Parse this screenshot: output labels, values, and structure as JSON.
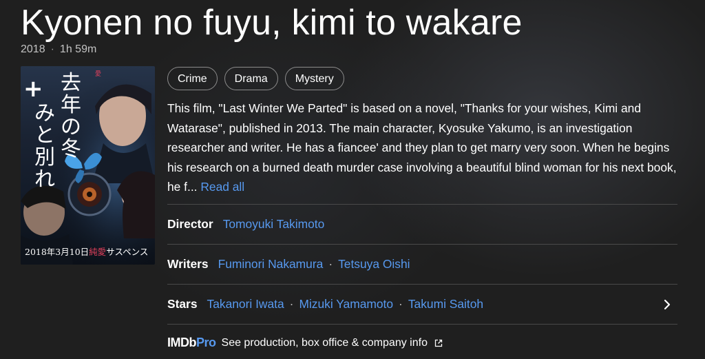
{
  "title": "Kyonen no fuyu, kimi to wakare",
  "meta": {
    "year": "2018",
    "separator": "·",
    "runtime": "1h 59m"
  },
  "poster": {
    "title_jp": "去年の冬、きみと別れ",
    "date_text": "2018年3月10日",
    "tagline_accent": "純愛",
    "tagline_rest": "サスペンス",
    "colors": {
      "accent": "#e0405b",
      "butterfly": "#4aa3e8"
    }
  },
  "genres": [
    "Crime",
    "Drama",
    "Mystery"
  ],
  "plot": {
    "text": "This film, \"Last Winter We Parted\" is based on a novel, \"Thanks for your wishes, Kimi and Watarase\", published in 2013. The main character, Kyosuke Yakumo, is an investigation researcher and writer. He has a fiancee' and they plan to get marry very soon. When he begins his research on a burned death murder case involving a beautiful blind woman for his next book, he f...",
    "read_all": "Read all"
  },
  "credits": {
    "separator": "·",
    "director": {
      "label": "Director",
      "names": [
        "Tomoyuki Takimoto"
      ]
    },
    "writers": {
      "label": "Writers",
      "names": [
        "Fuminori Nakamura",
        "Tetsuya Oishi"
      ]
    },
    "stars": {
      "label": "Stars",
      "names": [
        "Takanori Iwata",
        "Mizuki Yamamoto",
        "Takumi Saitoh"
      ],
      "chevron_icon": "chevron-right-icon"
    }
  },
  "imdbpro": {
    "logo_imdb": "IMDb",
    "logo_pro": "Pro",
    "text": "See production, box office & company info",
    "icon": "external-link-icon"
  },
  "colors": {
    "background": "#1f1f1f",
    "link": "#5799ef",
    "divider": "#4a4a4a",
    "chip_border": "#8c8c8c"
  }
}
